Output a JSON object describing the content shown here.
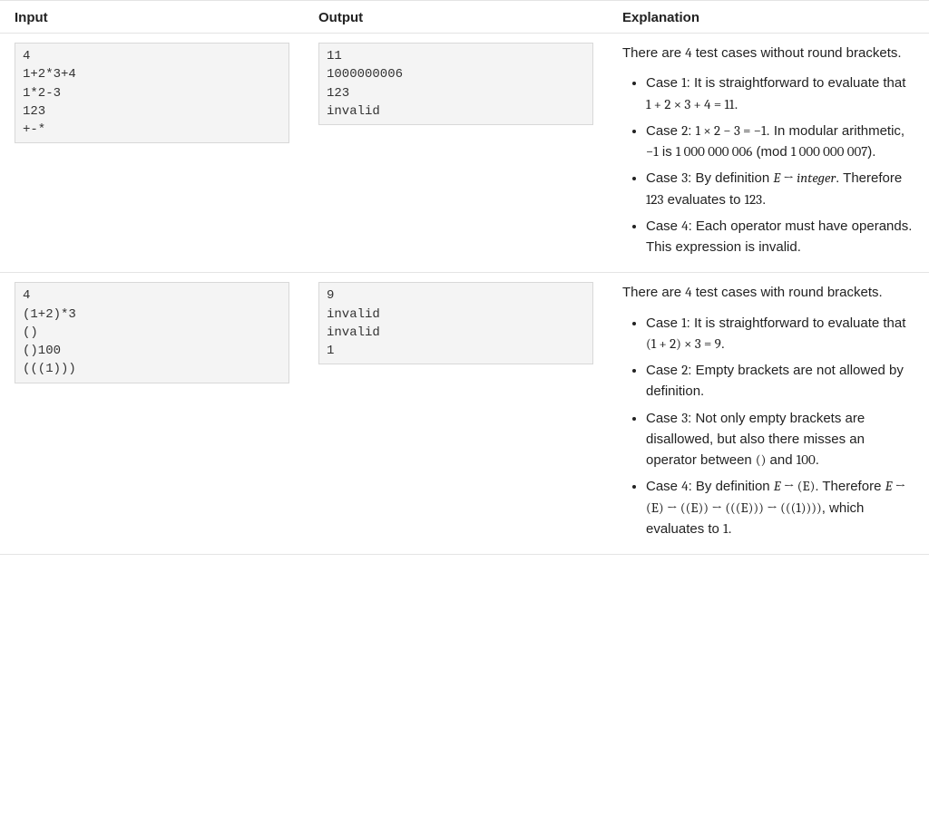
{
  "headers": {
    "input": "Input",
    "output": "Output",
    "explanation": "Explanation"
  },
  "rows": [
    {
      "input": "4\n1+2*3+4\n1*2-3\n123\n+-*",
      "output": "11\n1000000006\n123\ninvalid",
      "explain_intro_1": "There are ",
      "explain_intro_n": "4",
      "explain_intro_2": " test cases without round brackets.",
      "case1_a": "Case ",
      "case1_n": "1",
      "case1_b": ": It is straightforward to evaluate that ",
      "case1_expr": "1 + 2 × 3 + 4 = 11",
      "case1_c": ".",
      "case2_a": "Case ",
      "case2_n": "2",
      "case2_b": ": ",
      "case2_expr": "1 × 2 − 3 = −1",
      "case2_c": ". In modular arithmetic, ",
      "case2_neg1": "−1",
      "case2_d": " is ",
      "case2_v1": "1 000 000 006",
      "case2_e": " (mod ",
      "case2_v2": "1 000 000 007",
      "case2_f": ").",
      "case3_a": "Case ",
      "case3_n": "3",
      "case3_b": ": By definition ",
      "case3_E": "E",
      "case3_arrow": " → ",
      "case3_int": "integer",
      "case3_c": ". Therefore ",
      "case3_v": "123",
      "case3_d": " evaluates to ",
      "case3_v2": "123",
      "case3_e": ".",
      "case4_a": "Case ",
      "case4_n": "4",
      "case4_b": ": Each operator must have operands. This expression is invalid."
    },
    {
      "input": "4\n(1+2)*3\n()\n()100\n(((1)))",
      "output": "9\ninvalid\ninvalid\n1",
      "explain_intro_1": "There are ",
      "explain_intro_n": "4",
      "explain_intro_2": " test cases with round brackets.",
      "case1_a": "Case ",
      "case1_n": "1",
      "case1_b": ": It is straightforward to evaluate that ",
      "case1_expr": "(1 + 2) × 3 = 9",
      "case1_c": ".",
      "case2_a": "Case ",
      "case2_n": "2",
      "case2_b": ": Empty brackets are not allowed by definition.",
      "case3_a": "Case ",
      "case3_n": "3",
      "case3_b": ": Not only empty brackets are disallowed, but also there misses an operator between ",
      "case3_paren": "()",
      "case3_c": " and ",
      "case3_v": "100",
      "case3_d": ".",
      "case4_a": "Case ",
      "case4_n": "4",
      "case4_b": ": By definition ",
      "case4_E1": "E",
      "case4_arr1": " → ",
      "case4_paren1": "(E)",
      "case4_c": ". Therefore ",
      "case4_E2": "E",
      "case4_arr2": " → ",
      "case4_paren2": "(E)",
      "case4_arr3": " → ",
      "case4_paren3": "((E))",
      "case4_arr4": " → ",
      "case4_paren4": "(((E)))",
      "case4_arr5": " → ",
      "case4_paren5": "(((1))))",
      "case4_d": ", which evaluates to ",
      "case4_one": "1",
      "case4_e": "."
    }
  ]
}
